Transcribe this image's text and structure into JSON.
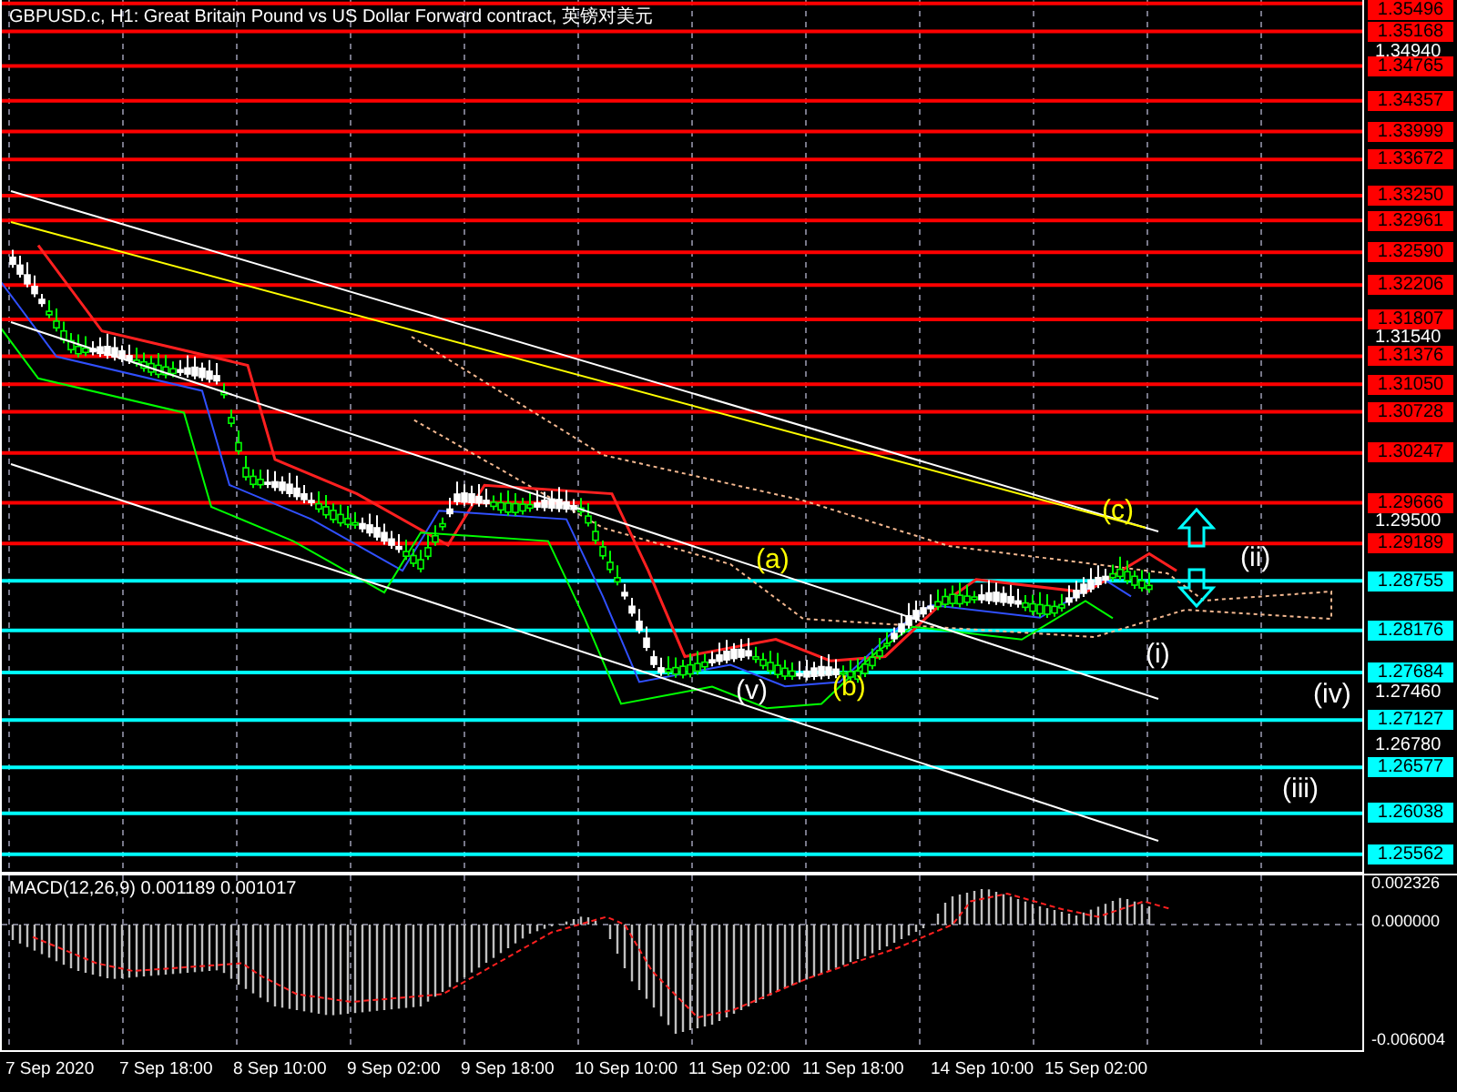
{
  "chart_title": "GBPUSD.c, H1:  Great Britain Pound vs US Dollar Forward contract, 英镑对美元",
  "price_axis": [
    "1.34940",
    "1.31540",
    "1.29500",
    "1.27460",
    "1.26780"
  ],
  "levels": [
    {
      "label": "1.35496",
      "color": "#ff0000"
    },
    {
      "label": "1.35168",
      "color": "#ff0000"
    },
    {
      "label": "1.34765",
      "color": "#ff0000"
    },
    {
      "label": "1.34357",
      "color": "#ff0000"
    },
    {
      "label": "1.33999",
      "color": "#ff0000"
    },
    {
      "label": "1.33672",
      "color": "#ff0000"
    },
    {
      "label": "1.33250",
      "color": "#ff0000"
    },
    {
      "label": "1.32961",
      "color": "#ff0000"
    },
    {
      "label": "1.32590",
      "color": "#ff0000"
    },
    {
      "label": "1.32206",
      "color": "#ff0000"
    },
    {
      "label": "1.31807",
      "color": "#ff0000"
    },
    {
      "label": "1.31376",
      "color": "#ff0000"
    },
    {
      "label": "1.31050",
      "color": "#ff0000"
    },
    {
      "label": "1.30728",
      "color": "#ff0000"
    },
    {
      "label": "1.30247",
      "color": "#ff0000"
    },
    {
      "label": "1.29666",
      "color": "#ff0000"
    },
    {
      "label": "1.29189",
      "color": "#ff0000"
    },
    {
      "label": "1.28755",
      "color": "#00ffff"
    },
    {
      "label": "1.28176",
      "color": "#00ffff"
    },
    {
      "label": "1.27684",
      "color": "#00ffff"
    },
    {
      "label": "1.27127",
      "color": "#00ffff"
    },
    {
      "label": "1.26577",
      "color": "#00ffff"
    },
    {
      "label": "1.26038",
      "color": "#00ffff"
    },
    {
      "label": "1.25562",
      "color": "#00ffff"
    }
  ],
  "wave_labels": [
    {
      "text": "(c)",
      "color": "#ffff00"
    },
    {
      "text": "(ii)",
      "color": "#ffffff"
    },
    {
      "text": "(a)",
      "color": "#ffff00"
    },
    {
      "text": "(i)",
      "color": "#ffffff"
    },
    {
      "text": "(v)",
      "color": "#ffffff"
    },
    {
      "text": "(b)",
      "color": "#ffff00"
    },
    {
      "text": "(iv)",
      "color": "#ffffff"
    },
    {
      "text": "(iii)",
      "color": "#ffffff"
    }
  ],
  "macd": {
    "title": "MACD(12,26,9) 0.001189 0.001017",
    "axis": [
      "0.002326",
      "0.000000",
      "-0.006004"
    ]
  },
  "time_axis": [
    "7 Sep 2020",
    "7 Sep 18:00",
    "8 Sep 10:00",
    "9 Sep 02:00",
    "9 Sep 18:00",
    "10 Sep 10:00",
    "11 Sep 02:00",
    "11 Sep 18:00",
    "14 Sep 10:00",
    "15 Sep 02:00"
  ]
}
